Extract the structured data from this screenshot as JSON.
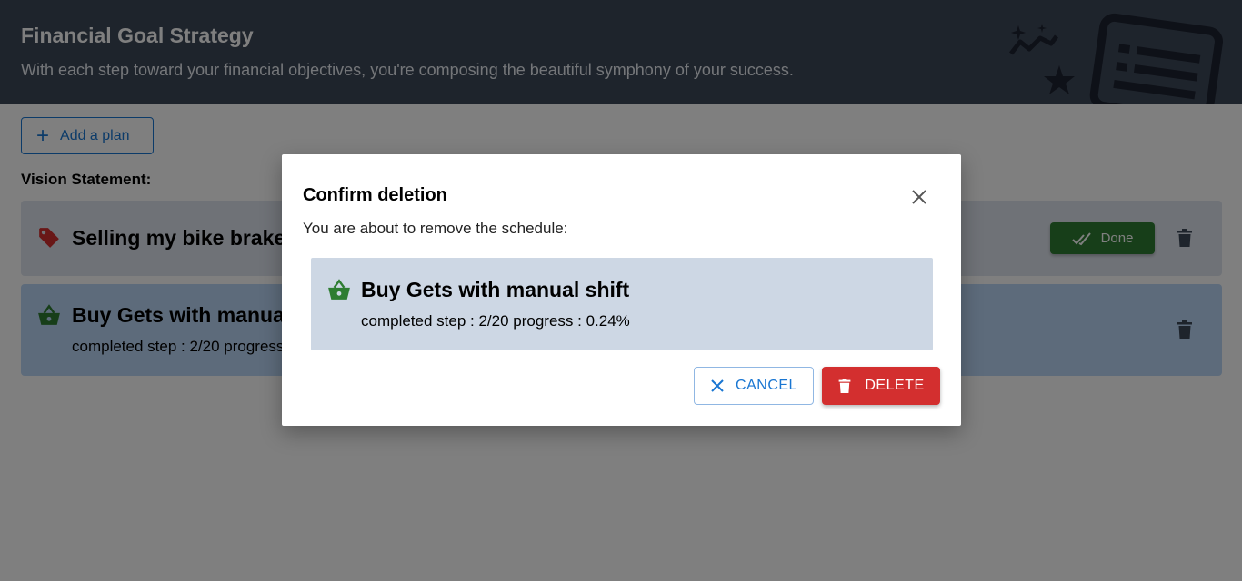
{
  "header": {
    "title": "Financial Goal Strategy",
    "subtitle": "With each step toward your financial objectives, you're composing the beautiful symphony of your success."
  },
  "toolbar": {
    "add_plan_label": "Add a plan"
  },
  "vision": {
    "label": "Vision Statement:"
  },
  "plans": [
    {
      "title": "Selling my bike brakes",
      "icon": "price-tag-icon",
      "color": "#d32f2f",
      "done_label": "Done"
    },
    {
      "title": "Buy Gets with manual shift",
      "icon": "basket-icon",
      "color": "#2e7d32",
      "meta": "completed step : 2/20  progress : 0.24%"
    }
  ],
  "dialog": {
    "title": "Confirm deletion",
    "message": "You are about to remove the schedule:",
    "preview_title": "Buy Gets with manual shift",
    "preview_meta": "completed step : 2/20  progress : 0.24%",
    "cancel_label": "CANCEL",
    "delete_label": "DELETE"
  },
  "colors": {
    "header_bg": "#3d4858",
    "primary": "#1976d2",
    "danger": "#d32f2f",
    "success": "#2e7d32"
  }
}
